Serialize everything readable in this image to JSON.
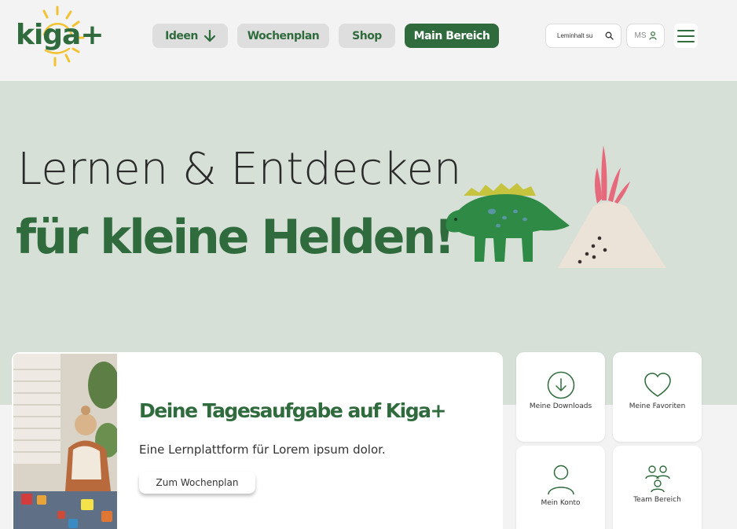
{
  "brand": {
    "logo_text": "kiga",
    "logo_plus": "+",
    "color_primary": "#2f6b3c",
    "color_sun": "#f2c230"
  },
  "nav": {
    "ideen": "Ideen",
    "wochenplan": "Wochenplan",
    "shop": "Shop",
    "main_bereich": "Main Bereich"
  },
  "search": {
    "placeholder": "Leminhalt su"
  },
  "user": {
    "initials": "MS"
  },
  "hero": {
    "line1": "Lernen & Entdecken",
    "line2": "für kleine Helden!",
    "background": "#d6e0d7"
  },
  "task": {
    "title": "Deine Tagesaufgabe auf Kiga+",
    "description": "Eine Lernplattform für Lorem ipsum dolor.",
    "button": "Zum Wochenplan"
  },
  "tiles": [
    {
      "label": "Meine Downloads",
      "icon": "download-circle-icon"
    },
    {
      "label": "Meine Favoriten",
      "icon": "heart-icon"
    },
    {
      "label": "Mein Konto",
      "icon": "user-icon"
    },
    {
      "label": "Team Bereich",
      "icon": "team-icon"
    }
  ]
}
